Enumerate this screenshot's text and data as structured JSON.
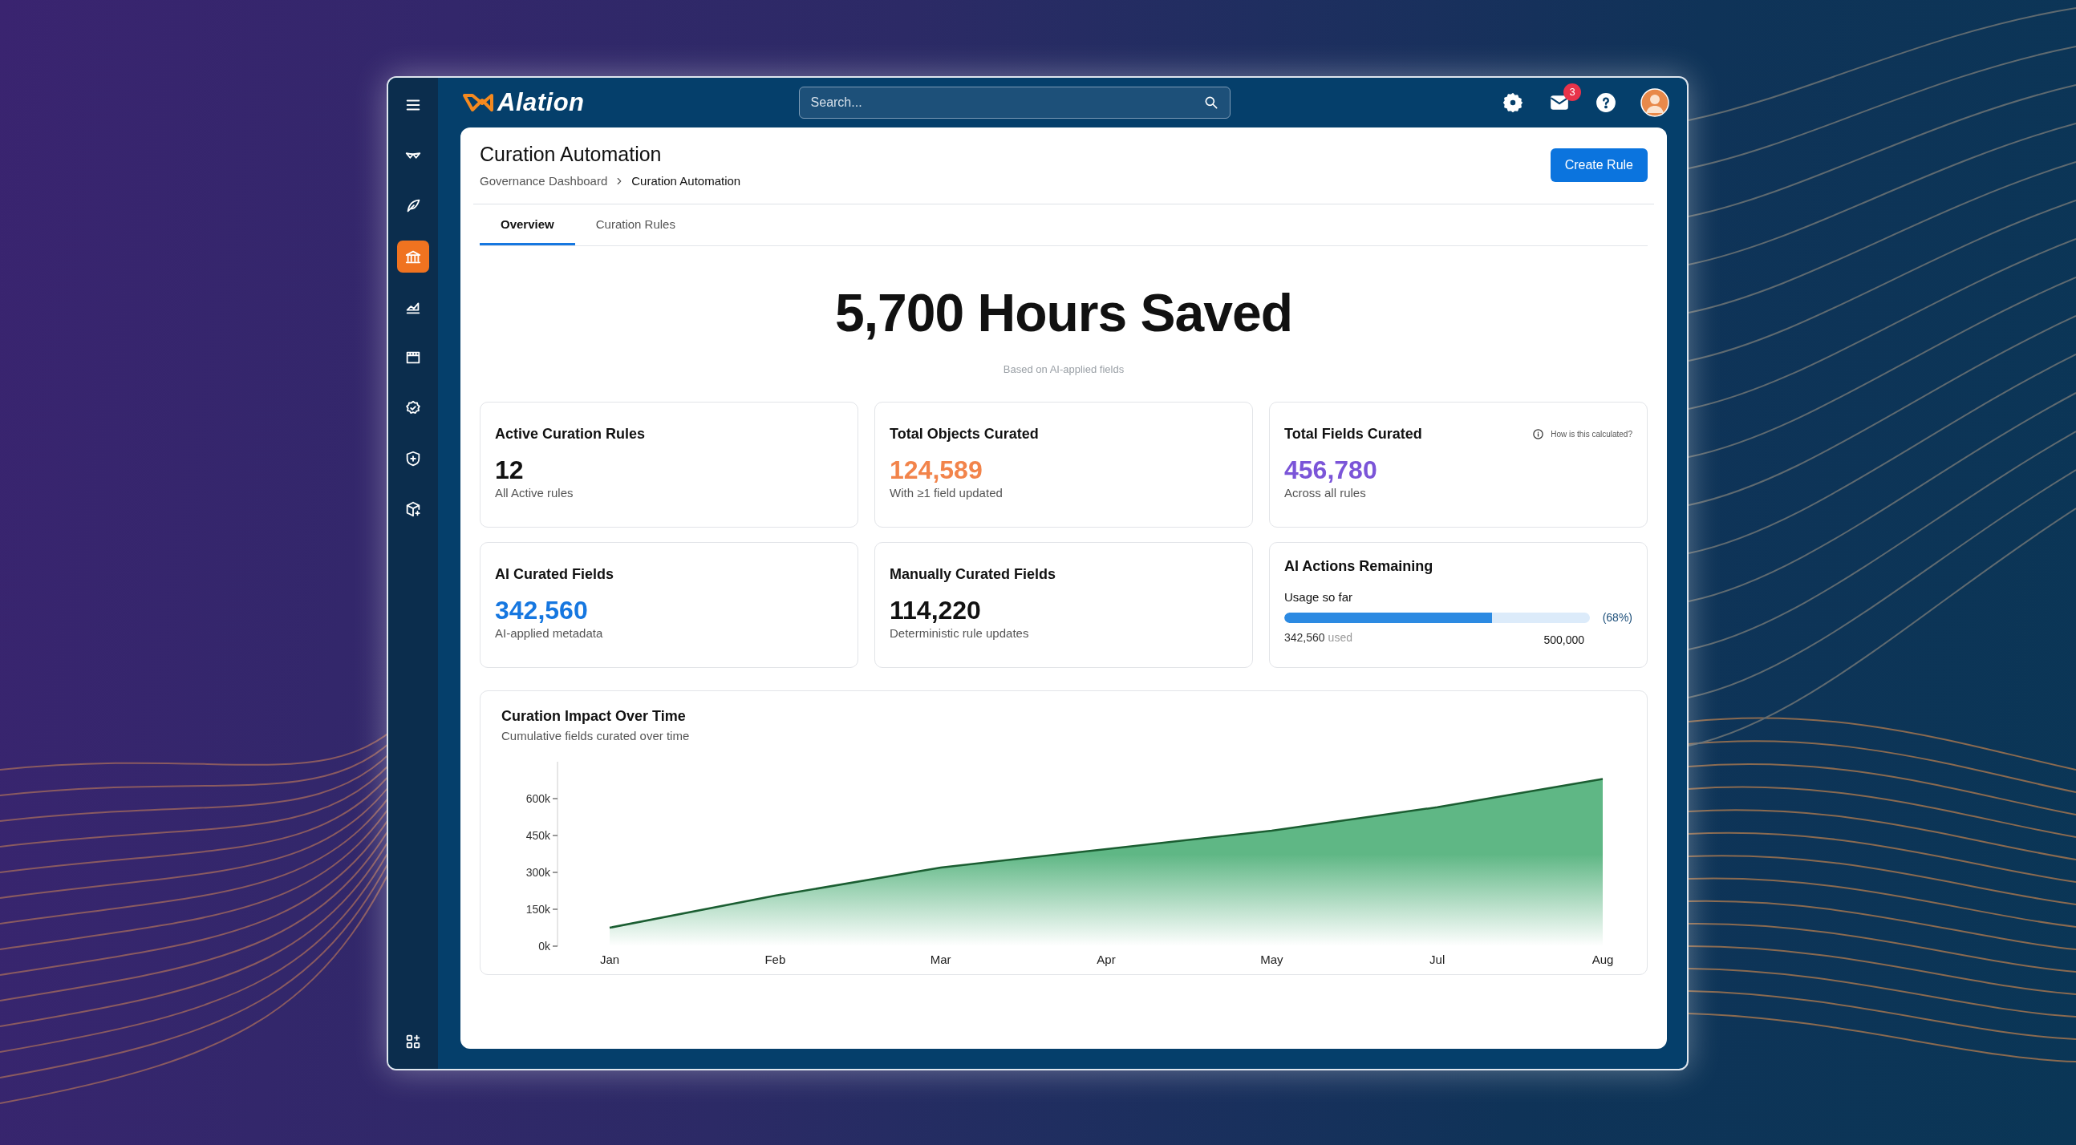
{
  "app": {
    "logo": "Alation"
  },
  "sidebar": {
    "items": [
      {
        "selected": false
      },
      {
        "selected": false
      },
      {
        "selected": true
      },
      {
        "selected": false
      },
      {
        "selected": false
      },
      {
        "selected": false
      },
      {
        "selected": false
      },
      {
        "selected": false
      }
    ]
  },
  "search": {
    "placeholder": "Search..."
  },
  "notifications": {
    "badge": "3"
  },
  "header": {
    "title": "Curation Automation",
    "breadcrumbs": [
      "Governance Dashboard",
      "Curation Automation"
    ],
    "button": "Create Rule"
  },
  "tabs": [
    {
      "label": "Overview",
      "selected": true
    },
    {
      "label": "Curation Rules",
      "selected": false
    }
  ],
  "hero": {
    "headline": "5,700 Hours Saved",
    "caption": "Based on AI-applied fields"
  },
  "stats": [
    {
      "title": "Active Curation Rules",
      "value": "12",
      "note": "All Active rules",
      "color": "#111111"
    },
    {
      "title": "Total Objects Curated",
      "value": "124,589",
      "note": "With ≥1 field updated",
      "color": "#f2844b"
    },
    {
      "title": "Total Fields Curated",
      "value": "456,780",
      "note": "Across all rules",
      "color": "#7b55d8",
      "help": "How is this calculated?"
    },
    {
      "title": "AI Curated Fields",
      "value": "342,560",
      "note": "AI-applied metadata",
      "color": "#1677e0"
    },
    {
      "title": "Manually Curated Fields",
      "value": "114,220",
      "note": "Deterministic rule updates",
      "color": "#111111"
    }
  ],
  "usage": {
    "title": "AI Actions Remaining",
    "label": "Usage so far",
    "level": 0.68,
    "percent": "(68%)",
    "used": "342,560",
    "used_suffix": "used",
    "total": "500,000"
  },
  "chart": {
    "title": "Curation Impact Over Time",
    "subtitle": "Cumulative fields curated over time",
    "chart_data": {
      "type": "area",
      "categories": [
        "Jan",
        "Feb",
        "Mar",
        "Apr",
        "May",
        "Jul",
        "Aug"
      ],
      "ylim": [
        0,
        750000
      ],
      "series": [
        {
          "color": "#1b5e32",
          "values": [
            75000,
            205000,
            320000,
            395000,
            470000,
            565000,
            680000
          ]
        }
      ],
      "yticks": [
        {
          "value": 0,
          "label": "0k"
        },
        {
          "value": 150000,
          "label": "150k"
        },
        {
          "value": 300000,
          "label": "300k"
        },
        {
          "value": 450000,
          "label": "450k"
        },
        {
          "value": 600000,
          "label": "600k"
        }
      ]
    }
  }
}
